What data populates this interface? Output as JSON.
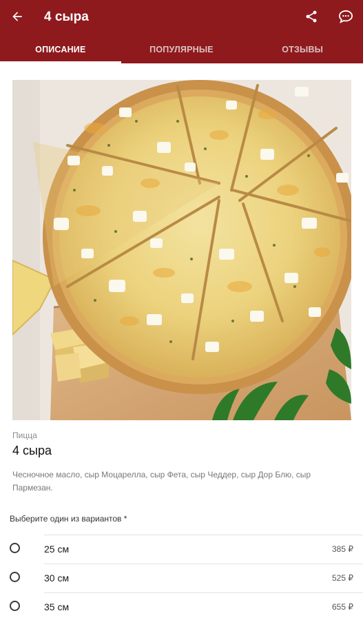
{
  "header": {
    "title": "4 сыра",
    "back_icon": "arrow-left-icon",
    "share_icon": "share-icon",
    "chat_icon": "chat-icon"
  },
  "tabs": [
    {
      "label": "ОПИСАНИЕ",
      "active": true
    },
    {
      "label": "ПОПУЛЯРНЫЕ",
      "active": false
    },
    {
      "label": "ОТЗЫВЫ",
      "active": false
    }
  ],
  "product": {
    "category": "Пицца",
    "name": "4 сыра",
    "description": "Чесночное масло, сыр Моцарелла, сыр Фета, сыр Чеддер, сыр Дор Блю, сыр Пармезан."
  },
  "variants": {
    "title": "Выберите один из вариантов *",
    "options": [
      {
        "label": "25 см",
        "price": "385 ₽"
      },
      {
        "label": "30 см",
        "price": "525 ₽"
      },
      {
        "label": "35 см",
        "price": "655 ₽"
      }
    ]
  },
  "colors": {
    "primary": "#8e1a1e",
    "tab_indicator": "#ffffff"
  }
}
